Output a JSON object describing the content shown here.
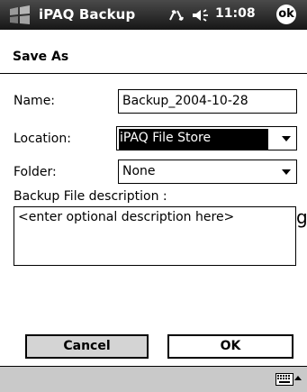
{
  "titlebar": {
    "app_title": "iPAQ Backup",
    "time": "11:08",
    "ok_label": "ok",
    "icons": [
      "windows-start-icon",
      "connectivity-icon",
      "volume-icon"
    ]
  },
  "header": {
    "title": "Save As"
  },
  "form": {
    "name_label": "Name:",
    "name_value": "Backup_2004-10-28",
    "location_label": "Location:",
    "location_value": "iPAQ File Store",
    "folder_label": "Folder:",
    "folder_value": "None",
    "description_label": "Backup File description :",
    "description_placeholder": "<enter optional description here>"
  },
  "buttons": {
    "cancel": "Cancel",
    "ok": "OK"
  },
  "bottombar": {
    "icons": [
      "keyboard-icon",
      "input-menu-arrow-icon"
    ]
  },
  "stray_glyph": "g",
  "colors": {
    "titlebar": "#222222",
    "selection": "#000000",
    "cancel_button": "#d4d4d4",
    "bottombar": "#c9c9c9"
  }
}
